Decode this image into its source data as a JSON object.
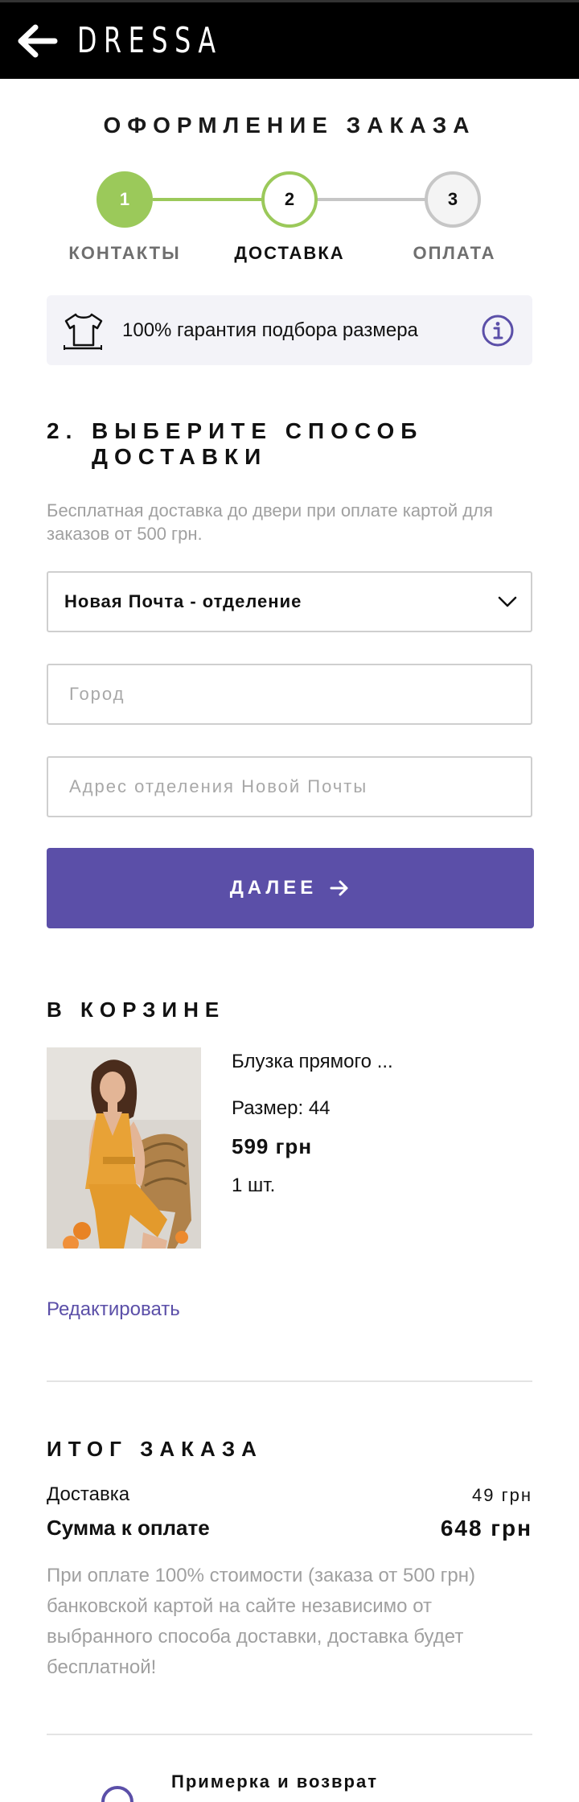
{
  "header": {
    "brand": "DRESSA",
    "back_icon": "arrow-left-icon"
  },
  "page_title": "ОФОРМЛЕНИЕ ЗАКАЗА",
  "stepper": {
    "steps": [
      {
        "number": "1",
        "label": "КОНТАКТЫ",
        "state": "completed"
      },
      {
        "number": "2",
        "label": "ДОСТАВКА",
        "state": "active"
      },
      {
        "number": "3",
        "label": "ОПЛАТА",
        "state": "upcoming"
      }
    ]
  },
  "guarantee": {
    "text": "100% гарантия подбора размера",
    "icon": "tshirt-icon",
    "info_icon": "info-icon"
  },
  "delivery": {
    "section_number": "2.",
    "title_line1": "ВЫБЕРИТЕ СПОСОБ",
    "title_line2": "ДОСТАВКИ",
    "hint": "Бесплатная доставка до двери при оплате картой для заказов от 500 грн.",
    "method_selected": "Новая Почта - отделение",
    "city_placeholder": "Город",
    "address_placeholder": "Адрес отделения Новой Почты",
    "next_button": "ДАЛЕЕ"
  },
  "cart": {
    "title": "В КОРЗИНЕ",
    "item": {
      "name": "Блузка прямого ...",
      "size": "Размер: 44",
      "price": "599 грн",
      "quantity": "1 шт."
    },
    "edit_link": "Редактировать"
  },
  "summary": {
    "title": "ИТОГ ЗАКАЗА",
    "delivery_label": "Доставка",
    "delivery_value": "49 грн",
    "total_label": "Сумма к оплате",
    "total_value": "648 грн",
    "note": "При оплате 100% стоимости (заказа от 500 грн) банковской картой на сайте независимо от выбранного способа доставки, доставка будет бесплатной!"
  },
  "returns": {
    "label": "Примерка и возврат",
    "icon": "return-icon"
  },
  "colors": {
    "accent": "#5b4fa8",
    "step_done": "#9bc95a",
    "header_bg": "#000000",
    "muted_text": "#a0a0a0"
  }
}
